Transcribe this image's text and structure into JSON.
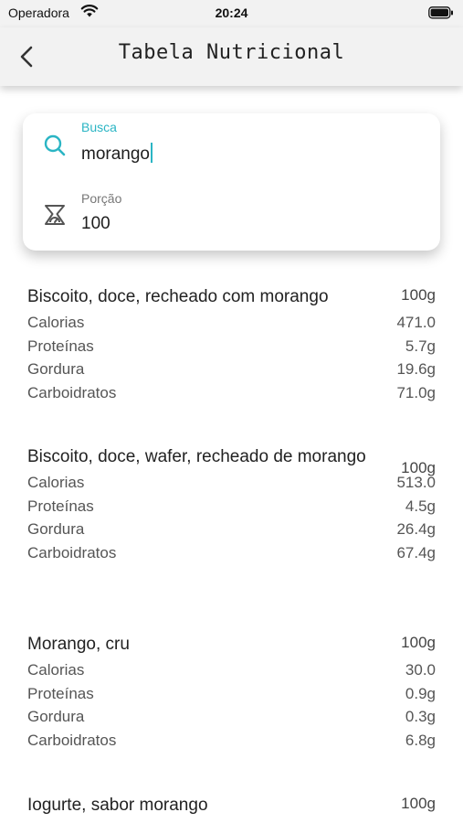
{
  "status_bar": {
    "carrier": "Operadora",
    "time": "20:24"
  },
  "header": {
    "title": "Tabela Nutricional"
  },
  "search": {
    "search_label": "Busca",
    "search_value": "morango",
    "portion_label": "Porção",
    "portion_value": "100"
  },
  "colors": {
    "accent": "#2bb5c4",
    "appbar_bg": "#f2f2f2"
  },
  "results": [
    {
      "name": "Biscoito, doce, recheado com morango",
      "portion": "100g",
      "nutrients": [
        {
          "label": "Calorias",
          "value": "471.0"
        },
        {
          "label": "Proteínas",
          "value": "5.7g"
        },
        {
          "label": "Gordura",
          "value": "19.6g"
        },
        {
          "label": "Carboidratos",
          "value": "71.0g"
        }
      ]
    },
    {
      "name": "Biscoito, doce, wafer, recheado de morango",
      "portion": "100g",
      "nutrients": [
        {
          "label": "Calorias",
          "value": "513.0"
        },
        {
          "label": "Proteínas",
          "value": "4.5g"
        },
        {
          "label": "Gordura",
          "value": "26.4g"
        },
        {
          "label": "Carboidratos",
          "value": "67.4g"
        }
      ]
    },
    {
      "name": "Morango, cru",
      "portion": "100g",
      "nutrients": [
        {
          "label": "Calorias",
          "value": "30.0"
        },
        {
          "label": "Proteínas",
          "value": "0.9g"
        },
        {
          "label": "Gordura",
          "value": "0.3g"
        },
        {
          "label": "Carboidratos",
          "value": "6.8g"
        }
      ]
    },
    {
      "name": "Iogurte, sabor morango",
      "portion": "100g",
      "nutrients": []
    }
  ]
}
